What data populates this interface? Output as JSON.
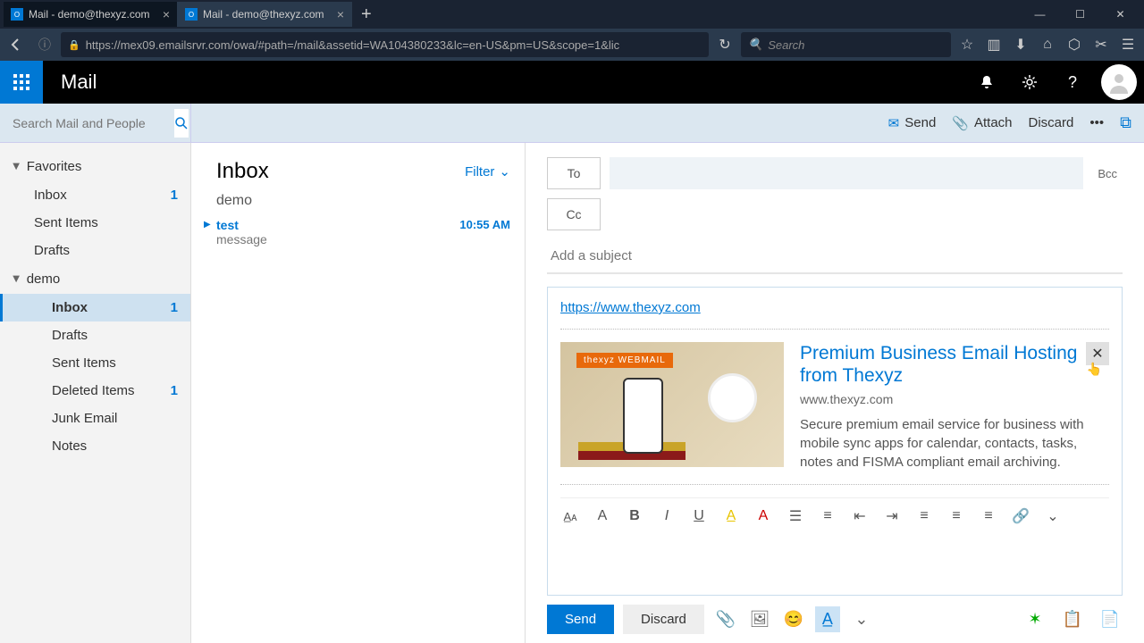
{
  "browser": {
    "tabs": [
      {
        "title": "Mail - demo@thexyz.com"
      },
      {
        "title": "Mail - demo@thexyz.com"
      }
    ],
    "url": "https://mex09.emailsrvr.com/owa/#path=/mail&assetid=WA104380233&lc=en-US&pm=US&scope=1&lic",
    "search_placeholder": "Search"
  },
  "header": {
    "title": "Mail"
  },
  "toolbar": {
    "search_placeholder": "Search Mail and People",
    "send": "Send",
    "attach": "Attach",
    "discard": "Discard"
  },
  "sidebar": {
    "favorites_label": "Favorites",
    "favorites": [
      {
        "name": "Inbox",
        "count": "1"
      },
      {
        "name": "Sent Items",
        "count": ""
      },
      {
        "name": "Drafts",
        "count": ""
      }
    ],
    "account_label": "demo",
    "folders": [
      {
        "name": "Inbox",
        "count": "1",
        "selected": true
      },
      {
        "name": "Drafts",
        "count": ""
      },
      {
        "name": "Sent Items",
        "count": ""
      },
      {
        "name": "Deleted Items",
        "count": "1"
      },
      {
        "name": "Junk Email",
        "count": ""
      },
      {
        "name": "Notes",
        "count": ""
      }
    ]
  },
  "messagelist": {
    "title": "Inbox",
    "filter": "Filter",
    "group": "demo",
    "items": [
      {
        "subject": "test",
        "time": "10:55 AM",
        "preview": "message"
      }
    ]
  },
  "compose": {
    "to_label": "To",
    "cc_label": "Cc",
    "bcc_label": "Bcc",
    "subject_placeholder": "Add a subject",
    "body_link": "https://www.thexyz.com",
    "preview": {
      "badge": "thexyz WEBMAIL",
      "title": "Premium Business Email Hosting from Thexyz",
      "domain": "www.thexyz.com",
      "desc": "Secure premium email service for business with mobile sync apps for calendar, contacts, tasks, notes and FISMA compliant email archiving.",
      "close": "✕"
    },
    "send": "Send",
    "discard": "Discard"
  }
}
